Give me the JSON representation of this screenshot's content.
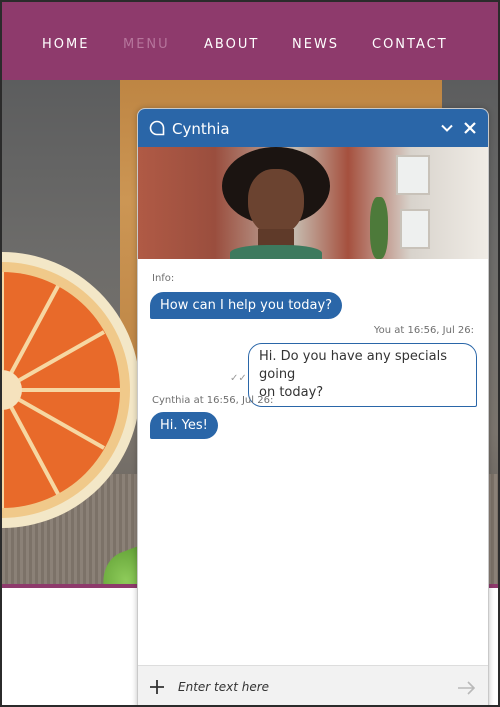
{
  "nav": {
    "items": [
      {
        "label": "HOME",
        "active": false
      },
      {
        "label": "MENU",
        "active": true
      },
      {
        "label": "ABOUT",
        "active": false
      },
      {
        "label": "NEWS",
        "active": false
      },
      {
        "label": "CONTACT",
        "active": false
      }
    ]
  },
  "colors": {
    "nav_bg": "#8e3a6c",
    "nav_active": "#b6759c",
    "chat_accent": "#2a66a8"
  },
  "chat": {
    "agent_name": "Cynthia",
    "icons": {
      "header": "chat-bubble-icon",
      "minimize": "chevron-down-icon",
      "close": "close-icon",
      "add": "plus-icon",
      "send": "send-arrow-icon"
    },
    "messages": [
      {
        "meta": "Info:",
        "text": "How can I help you today?",
        "from": "agent"
      },
      {
        "meta": "You at 16:56, Jul 26:",
        "text_lines": [
          "Hi. Do you have any specials going",
          "on today?"
        ],
        "from": "user",
        "read_mark": "✓✓"
      },
      {
        "meta": "Cynthia at 16:56, Jul 26:",
        "text": "Hi. Yes!",
        "from": "agent"
      }
    ],
    "input": {
      "placeholder": "Enter text here",
      "value": ""
    }
  }
}
